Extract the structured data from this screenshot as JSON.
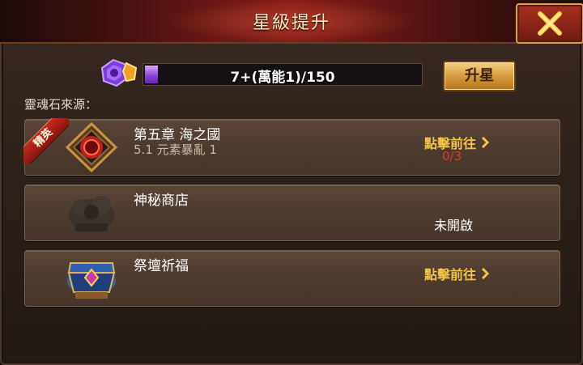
{
  "window": {
    "title": "星級提升"
  },
  "close": {
    "icon": "close-x-icon"
  },
  "progress": {
    "text": "7+(萬能1)/150",
    "value": 7,
    "max": 150,
    "fill_color": "#9a4ce0"
  },
  "upgrade_button": {
    "label": "升星"
  },
  "sources": {
    "label": "靈魂石來源：",
    "items": [
      {
        "badge": "精英",
        "icon": "elite-stage-medallion-icon",
        "name": "第五章 海之國",
        "sub": "5.1 元素暴亂 1",
        "action": "點擊前往",
        "count": "0/3"
      },
      {
        "icon": "mystery-shop-icon",
        "name": "神秘商店",
        "status": "未開啟"
      },
      {
        "icon": "altar-chest-icon",
        "name": "祭壇祈福",
        "action": "點擊前往"
      }
    ]
  },
  "colors": {
    "accent_gold": "#f2c444",
    "count_red": "#e03a2a",
    "title_bar": "#8a1c18"
  }
}
